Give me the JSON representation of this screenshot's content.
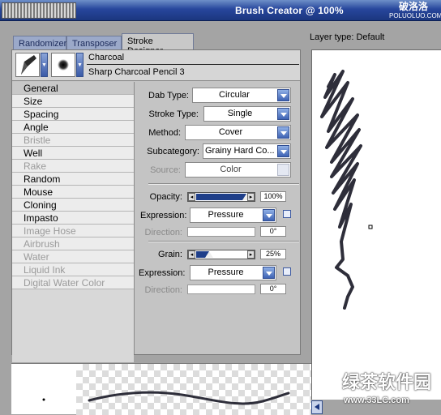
{
  "window": {
    "title": "Brush Creator @ 100%",
    "watermark_top": "破洛洛",
    "watermark_top_sub": "POLUOLUO.COM"
  },
  "tabs": [
    {
      "label": "Randomizer"
    },
    {
      "label": "Transposer"
    },
    {
      "label": "Stroke Designer",
      "active": true
    }
  ],
  "brush": {
    "category": "Charcoal",
    "variant": "Sharp Charcoal Pencil 3"
  },
  "categories": [
    {
      "label": "General",
      "selected": true,
      "enabled": true
    },
    {
      "label": "Size",
      "enabled": true
    },
    {
      "label": "Spacing",
      "enabled": true
    },
    {
      "label": "Angle",
      "enabled": true
    },
    {
      "label": "Bristle",
      "enabled": false
    },
    {
      "label": "Well",
      "enabled": true
    },
    {
      "label": "Rake",
      "enabled": false
    },
    {
      "label": "Random",
      "enabled": true
    },
    {
      "label": "Mouse",
      "enabled": true
    },
    {
      "label": "Cloning",
      "enabled": true
    },
    {
      "label": "Impasto",
      "enabled": true
    },
    {
      "label": "Image Hose",
      "enabled": false
    },
    {
      "label": "Airbrush",
      "enabled": false
    },
    {
      "label": "Water",
      "enabled": false
    },
    {
      "label": "Liquid Ink",
      "enabled": false
    },
    {
      "label": "Digital Water Color",
      "enabled": false
    }
  ],
  "general": {
    "dab_type_label": "Dab Type:",
    "dab_type_value": "Circular",
    "stroke_type_label": "Stroke Type:",
    "stroke_type_value": "Single",
    "method_label": "Method:",
    "method_value": "Cover",
    "subcategory_label": "Subcategory:",
    "subcategory_value": "Grainy Hard Co...",
    "source_label": "Source:",
    "source_value": "Color",
    "opacity_label": "Opacity:",
    "opacity_value": "100%",
    "opacity_fraction": 1.0,
    "opacity_expression_label": "Expression:",
    "opacity_expression_value": "Pressure",
    "opacity_direction_label": "Direction:",
    "opacity_direction_value": "0°",
    "grain_label": "Grain:",
    "grain_value": "25%",
    "grain_fraction": 0.25,
    "grain_expression_label": "Expression:",
    "grain_expression_value": "Pressure",
    "grain_direction_label": "Direction:",
    "grain_direction_value": "0°"
  },
  "layer": {
    "label": "Layer type: Default"
  },
  "watermark_bottom": {
    "big": "绿茶软件园",
    "url": "www.33LC.com"
  },
  "colors": {
    "titlebar": "#1b367f",
    "accent": "#3f63b4",
    "stroke": "#2e2e3a"
  }
}
